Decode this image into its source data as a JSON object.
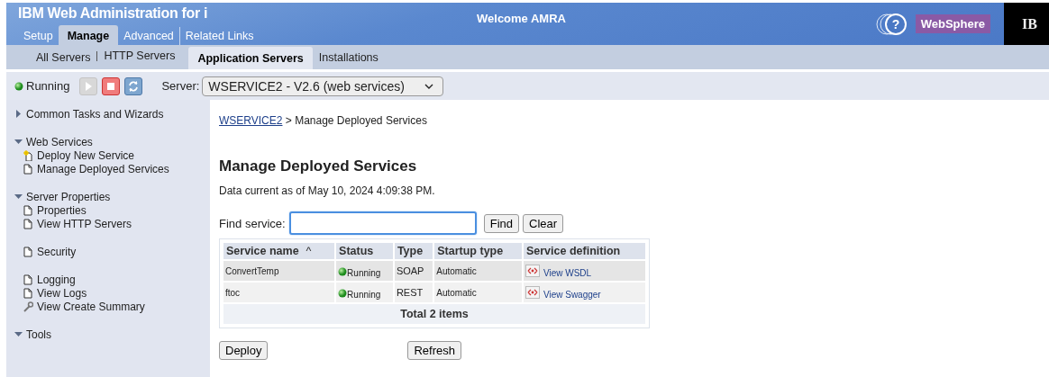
{
  "header": {
    "title": "IBM Web Administration for i",
    "welcome": "Welcome  AMRA",
    "help": "?",
    "brand": "WebSphere",
    "logo": "IB",
    "tabs": [
      {
        "label": "Setup",
        "selected": false
      },
      {
        "label": "Manage",
        "selected": true
      },
      {
        "label": "Advanced",
        "selected": false
      },
      {
        "label": "Related Links",
        "selected": false
      }
    ]
  },
  "subtabs": [
    {
      "label": "All Servers",
      "selected": false
    },
    {
      "label": "HTTP Servers",
      "selected": false
    },
    {
      "label": "Application Servers",
      "selected": true
    },
    {
      "label": "Installations",
      "selected": false
    }
  ],
  "toolbar": {
    "status": "Running",
    "start_disabled": true,
    "server_label": "Server:",
    "server": "WSERVICE2 - V2.6 (web services)"
  },
  "sidebar": [
    {
      "title": "Common Tasks and Wizards",
      "expanded": false
    },
    {
      "title": "Web Services",
      "expanded": true,
      "items": [
        {
          "label": "Deploy New Service",
          "kind": "new"
        },
        {
          "label": "Manage Deployed Services",
          "kind": "page"
        }
      ]
    },
    {
      "title": "Server Properties",
      "expanded": true,
      "items": [
        {
          "label": "Properties",
          "kind": "page"
        },
        {
          "label": "View HTTP Servers",
          "kind": "page"
        }
      ]
    },
    {
      "items": [
        {
          "label": "Security",
          "kind": "page"
        }
      ]
    },
    {
      "items": [
        {
          "label": "Logging",
          "kind": "page"
        },
        {
          "label": "View Logs",
          "kind": "page"
        },
        {
          "label": "View Create Summary",
          "kind": "tool"
        }
      ]
    },
    {
      "title": "Tools",
      "expanded": true
    }
  ],
  "breadcrumb": {
    "link": "WSERVICE2",
    "rest": " > Manage Deployed Services"
  },
  "heading": "Manage Deployed Services",
  "data_current": "Data current as of May 10, 2024 4:09:38 PM.",
  "find": {
    "label": "Find service:",
    "buttons": [
      "Find",
      "Clear"
    ]
  },
  "table": {
    "columns": [
      "Service name",
      "Status",
      "Type",
      "Startup type",
      "Service definition"
    ],
    "sort_arrow": "^",
    "rows": [
      {
        "name": "ConvertTemp",
        "status": "Running",
        "type": "SOAP",
        "startup": "Automatic",
        "definition": "View WSDL"
      },
      {
        "name": "ftoc",
        "status": "Running",
        "type": "REST",
        "startup": "Automatic",
        "definition": "View Swagger"
      }
    ],
    "footer": "Total 2 items"
  },
  "actions": [
    "Deploy",
    "Refresh"
  ]
}
